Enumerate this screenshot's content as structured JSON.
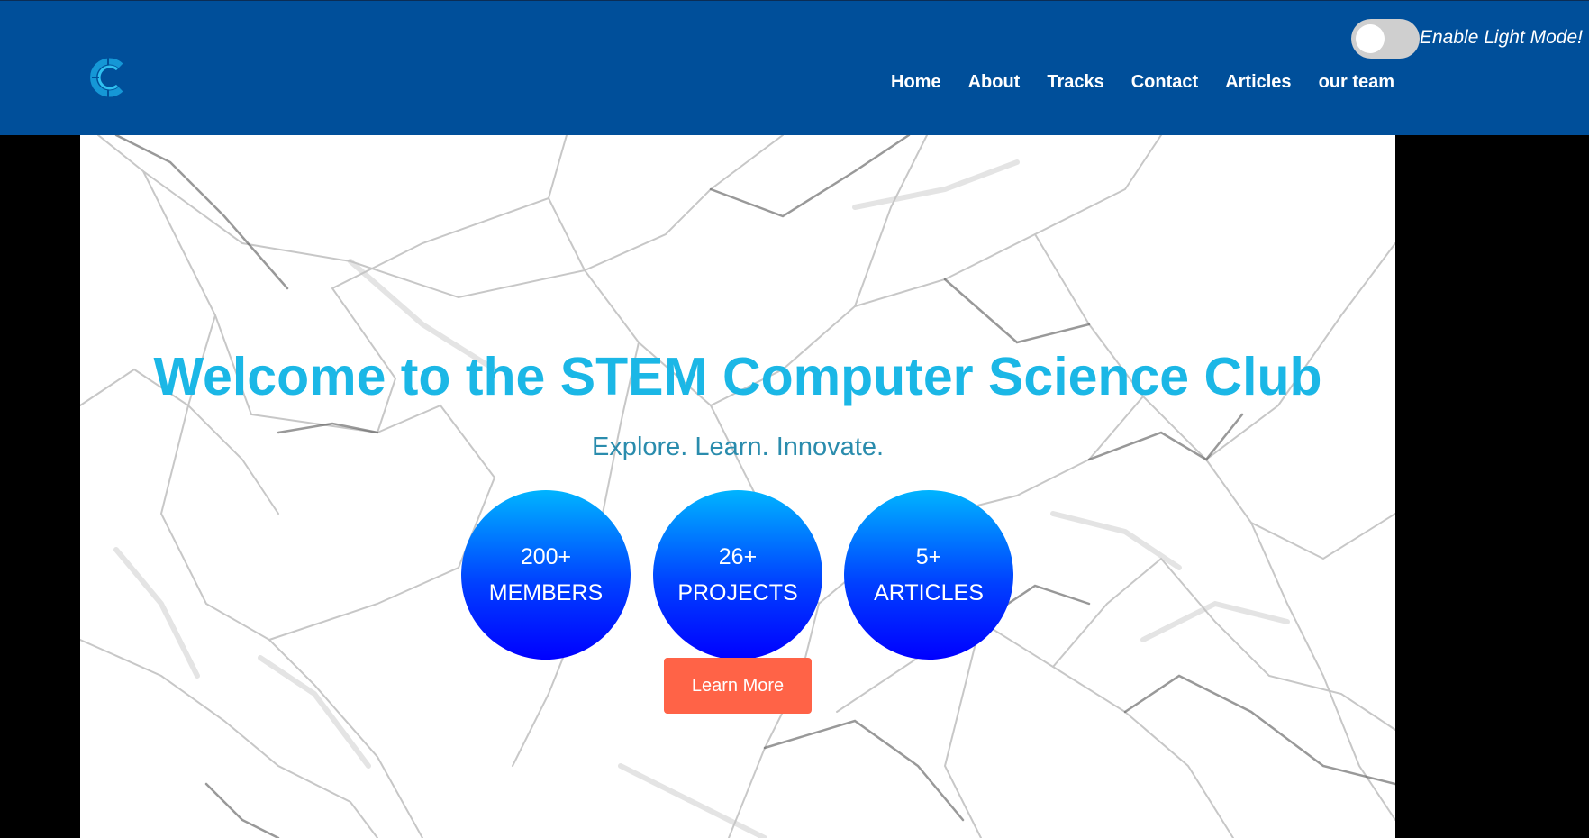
{
  "header": {
    "logo_icon": "c-logo-icon",
    "theme_toggle_label": "Enable Light Mode!",
    "nav": [
      {
        "label": "Home"
      },
      {
        "label": "About"
      },
      {
        "label": "Tracks"
      },
      {
        "label": "Contact"
      },
      {
        "label": "Articles"
      },
      {
        "label": "our team"
      }
    ]
  },
  "hero": {
    "title": "Welcome to the STEM Computer Science Club",
    "subtitle": "Explore. Learn. Innovate.",
    "stats": [
      {
        "value": "200+",
        "label": "MEMBERS"
      },
      {
        "value": "26+",
        "label": "PROJECTS"
      },
      {
        "value": "5+",
        "label": "ARTICLES"
      }
    ],
    "cta_label": "Learn More"
  },
  "colors": {
    "header_bg": "#004f9a",
    "title": "#1bb7e6",
    "subtitle": "#2a8cad",
    "cta_bg": "#ff6347",
    "stat_gradient_top": "#00b4ff",
    "stat_gradient_bottom": "#0000ff"
  }
}
